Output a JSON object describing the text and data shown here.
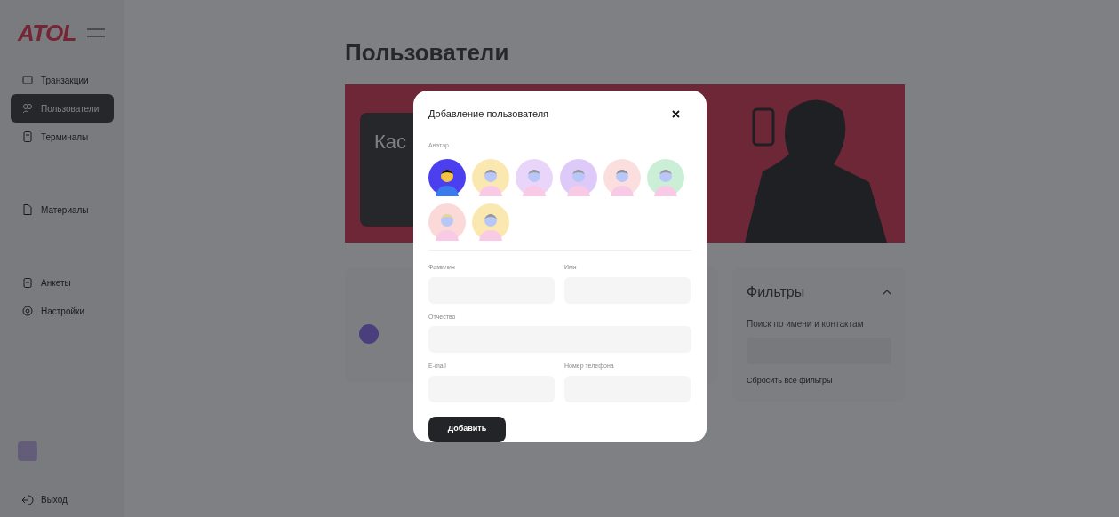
{
  "sidebar": {
    "logo": "ATOL",
    "items": [
      {
        "label": "Транзакции",
        "selected": false
      },
      {
        "label": "Пользователи",
        "selected": true
      },
      {
        "label": "Терминалы",
        "selected": false
      },
      {
        "label": "Материалы",
        "selected": false
      },
      {
        "label": "Анкеты",
        "selected": false
      },
      {
        "label": "Настройки",
        "selected": false
      }
    ],
    "logout": "Выход"
  },
  "page": {
    "title": "Пользователи",
    "banner_title": "Кас"
  },
  "filters": {
    "title": "Фильтры",
    "expanded": true,
    "search_label": "Поиск по имени и контактам",
    "reset": "Сбросить все фильтры"
  },
  "dialog": {
    "title": "Добавление пользователя",
    "avatar_label": "Аватар",
    "avatars": [
      {
        "selected": true
      },
      {
        "selected": false
      },
      {
        "selected": false
      },
      {
        "selected": false
      },
      {
        "selected": false
      },
      {
        "selected": false
      },
      {
        "selected": false
      },
      {
        "selected": false
      }
    ],
    "fields": [
      {
        "label": "Фамилия",
        "wide": false
      },
      {
        "label": "Имя",
        "wide": false
      },
      {
        "label": "Отчество",
        "wide": true
      },
      {
        "label": "E-mail",
        "wide": false
      },
      {
        "label": "Номер телефона",
        "wide": false
      }
    ],
    "submit": "Добавить"
  }
}
